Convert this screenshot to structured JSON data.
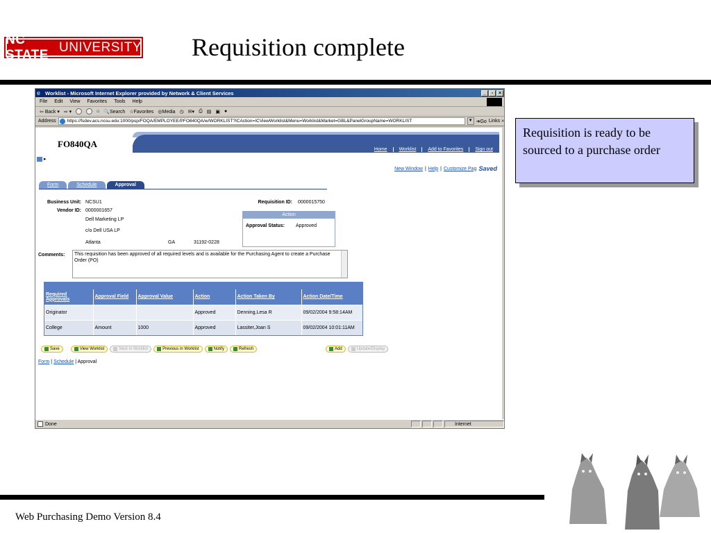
{
  "slide": {
    "logo_bold": "NC STATE",
    "logo_rest": "UNIVERSITY",
    "title": "Requisition complete",
    "callout": "Requisition is ready to be sourced to a purchase order",
    "footer": "Web Purchasing Demo Version 8.4"
  },
  "browser": {
    "title": "Worklist - Microsoft Internet Explorer provided by Network & Client Services",
    "menu": [
      "File",
      "Edit",
      "View",
      "Favorites",
      "Tools",
      "Help"
    ],
    "toolbar": {
      "back": "Back",
      "search": "Search",
      "favorites": "Favorites",
      "media": "Media"
    },
    "address_label": "Address",
    "url": "https://fsdev.acs.ncsu.edu:1000/psp/FOQA/EMPLOYEE/PFO840QA/w/WORKLIST?ICAction=ICViewWorklist&Menu=Worklist&Market=GBL&PanelGroupName=WORKLIST",
    "go": "Go",
    "links": "Links",
    "status_text": "Done",
    "zone": "Internet"
  },
  "ps": {
    "brand": "FO840QA",
    "nav": [
      "Home",
      "Worklist",
      "Add to Favorites",
      "Sign out"
    ],
    "links": {
      "new_window": "New Window",
      "help": "Help",
      "customize": "Customize Pag",
      "saved": "Saved"
    },
    "tabs": [
      "Form",
      "Schedule",
      "Approval"
    ],
    "form": {
      "business_unit_label": "Business Unit:",
      "business_unit": "NCSU1",
      "vendor_id_label": "Vendor ID:",
      "vendor_id": "0000001657",
      "vendor_name": "Dell Marketing LP",
      "vendor_addr": "c/o Dell USA LP",
      "city": "Atlanta",
      "state": "GA",
      "zip": "31192-0228",
      "req_id_label": "Requisition ID:",
      "req_id": "0000015750",
      "action_head": "Action",
      "approval_status_label": "Approval Status:",
      "approval_status": "Approved",
      "comments_label": "Comments:",
      "comments": "This requisition has been approved of all required levels and is available for the Purchasing Agent to create a Purchase Order (PO)"
    },
    "grid": {
      "headers": [
        "Required Approvals",
        "Approval Field",
        "Approval Value",
        "Action",
        "Action Taken By",
        "Action Date/Time"
      ],
      "rows": [
        [
          "Originator",
          "",
          "",
          "Approved",
          "Denning,Lesa R",
          "09/02/2004 9:58:14AM"
        ],
        [
          "College",
          "Amount",
          "1000",
          "Approved",
          "Lassiter,Joan S",
          "09/02/2004 10:01:11AM"
        ]
      ]
    },
    "buttons": {
      "save": "Save",
      "view_worklist": "View Worklist",
      "next_in_worklist": "Next in Worklist",
      "previous_in_worklist": "Previous in Worklist",
      "notify": "Notify",
      "refresh": "Refresh",
      "add": "Add",
      "update_display": "Update/Display"
    },
    "bottom_links": [
      "Form",
      "Schedule",
      "Approval"
    ]
  }
}
